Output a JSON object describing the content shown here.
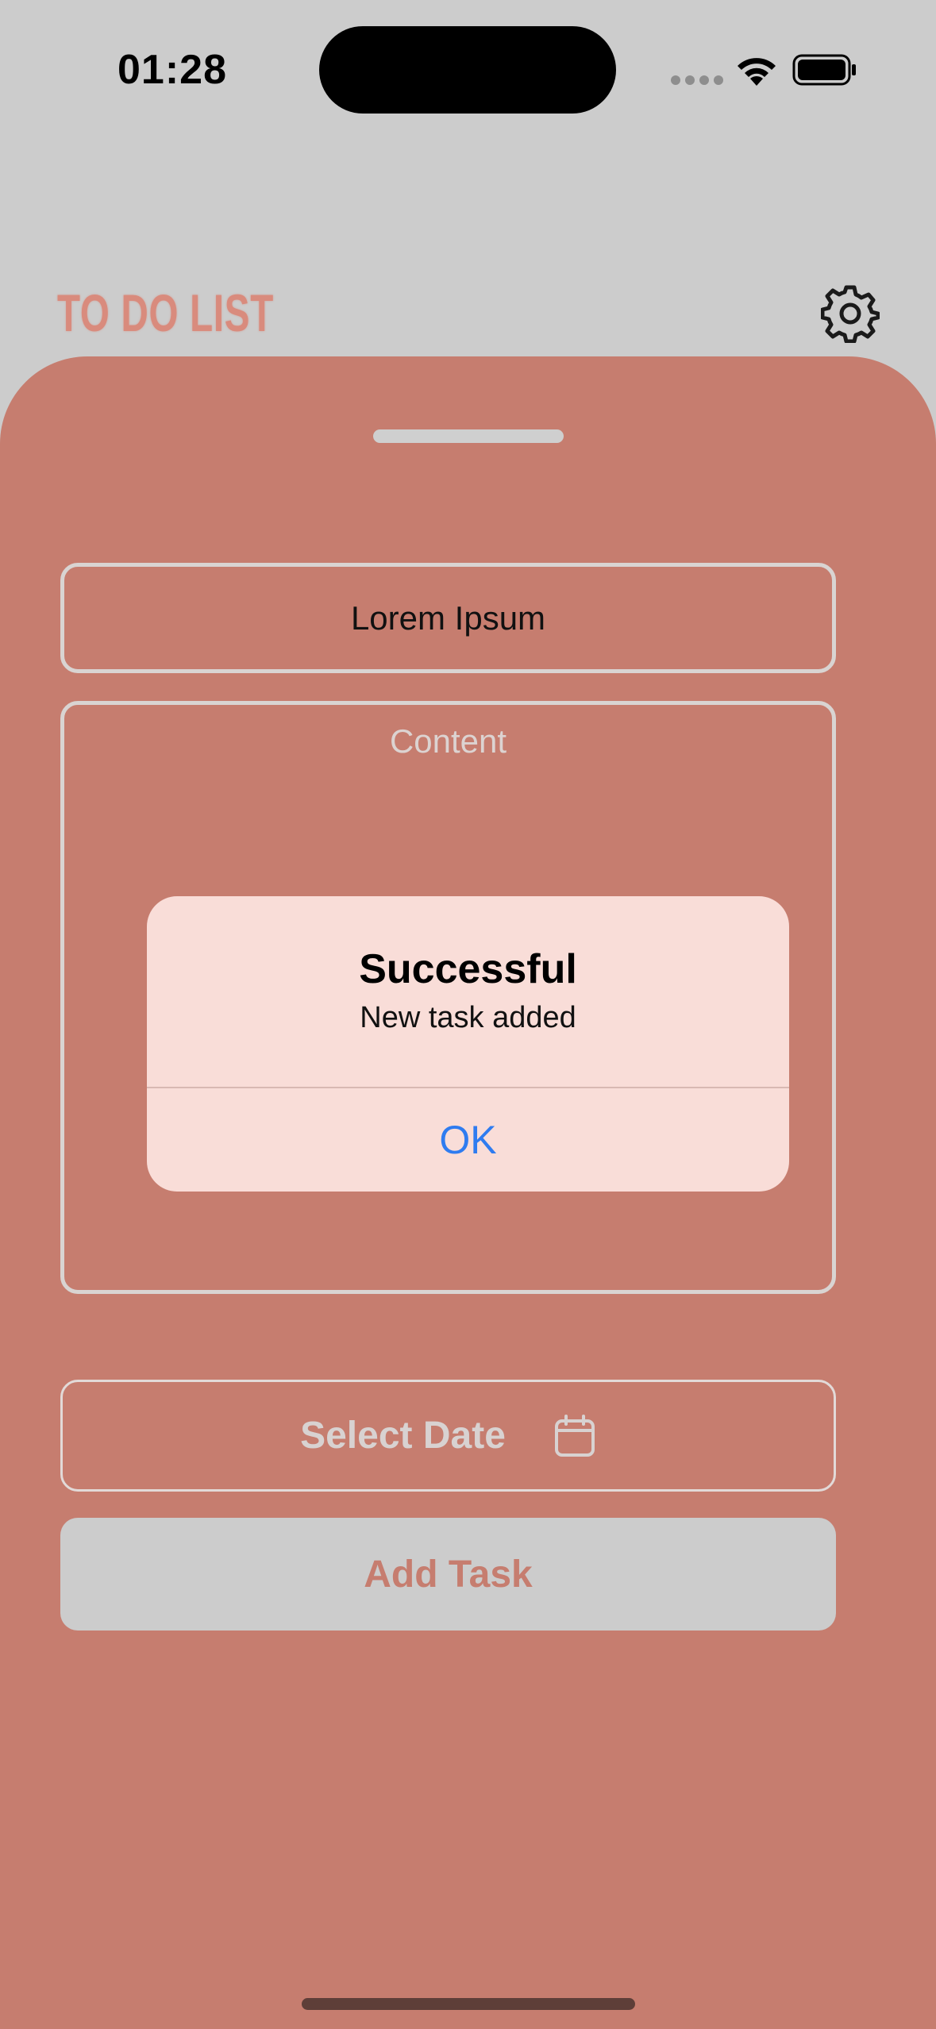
{
  "status_bar": {
    "time": "01:28"
  },
  "header": {
    "title": "TO DO LIST",
    "settings_icon": "gear-icon"
  },
  "form": {
    "title_value": "Lorem Ipsum",
    "content_placeholder": "Content",
    "date_button_label": "Select Date",
    "date_icon": "calendar-icon",
    "add_button_label": "Add Task"
  },
  "alert": {
    "title": "Successful",
    "message": "New task added",
    "ok_label": "OK"
  },
  "colors": {
    "background": "#cccccc",
    "sheet": "#c67d6f",
    "title_accent": "#d98b7d",
    "alert_background": "#f9ddd8",
    "alert_button": "#2f7cf0"
  }
}
